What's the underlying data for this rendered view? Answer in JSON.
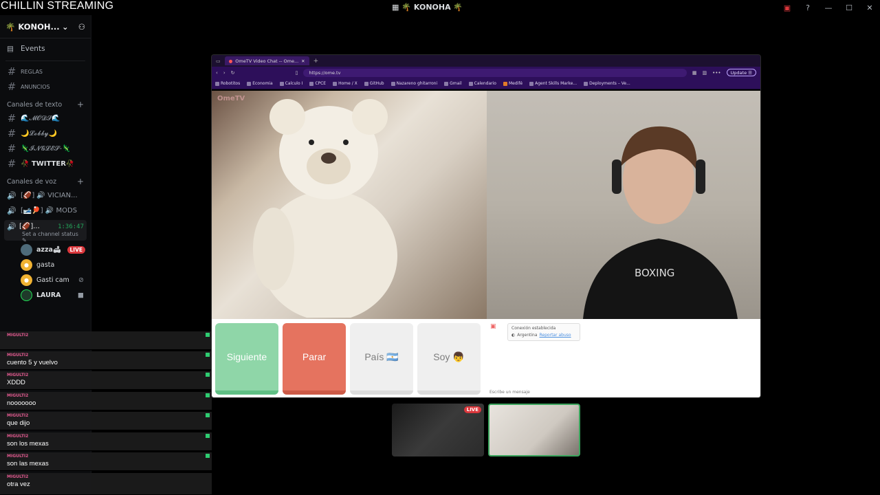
{
  "window": {
    "stream_title": "CHILLIN STREAMING",
    "server_title": "🌴 KONOHA 🌴"
  },
  "sidebar": {
    "server_name": "🌴 KONOH...",
    "events_label": "Events",
    "channels_top": [
      "REGLAS",
      "ANUNCIOS"
    ],
    "text_category": "Canales de texto",
    "text_channels": [
      "🌊𝓜𝓞𝓓𝓢🌊",
      "🌙𝓛𝓸𝓫𝓫𝔂🌙",
      "🦎𝓘𝓝𝓖𝓛𝓔𝓢-🦎",
      "🥀 TWITTER🥀"
    ],
    "voice_category": "Canales de voz",
    "voice_channels": [
      "[🏈] 🔊 VICIAN...",
      "[🎿🏓] 🔊 MODS"
    ],
    "active_voice": {
      "label": "[🏈]...",
      "time": "1:36:47",
      "status": "Set a channel status"
    },
    "voice_users": [
      {
        "name": "azza🛋",
        "live": "LIVE"
      },
      {
        "name": "gasta"
      },
      {
        "name": "Gasti cam"
      },
      {
        "name": "LAURA"
      }
    ]
  },
  "chat_overlay": {
    "messages": [
      {
        "user": "MIGULTI2",
        "text": ""
      },
      {
        "user": "MIGULTI2",
        "text": "cuento 5 y vuelvo"
      },
      {
        "user": "MIGULTI2",
        "text": "XDDD"
      },
      {
        "user": "MIGULTI2",
        "text": "nooooooo"
      },
      {
        "user": "MIGULTI2",
        "text": "que dijo"
      },
      {
        "user": "MIGULTI2",
        "text": "son los mexas"
      },
      {
        "user": "MIGULTI2",
        "text": "son las mexas"
      },
      {
        "user": "MIGULTI2",
        "text": "otra vez"
      }
    ]
  },
  "browser": {
    "tab_title": "OmeTV Video Chat -- Ome...",
    "url": "https://ome.tv",
    "update_label": "Update",
    "bookmarks": [
      "Robotitos",
      "Economia",
      "Calculo I",
      "CPCE",
      "Home / X",
      "GitHub",
      "Nazareno ghitarroni",
      "Gmail",
      "Calendario",
      "Medifé",
      "Agent Skills Marke...",
      "Deployments – Ve..."
    ],
    "logo": "OmeTV"
  },
  "ometv": {
    "buttons": {
      "next": "Siguiente",
      "stop": "Parar",
      "country": "País 🇦🇷",
      "me": "Soy 👦"
    },
    "connection": {
      "status": "Conexión establecida",
      "country": "Argentina",
      "report": "Reportar abuso"
    },
    "message_placeholder": "Escribe un mensaje"
  },
  "thumbnails": {
    "live_label": "LIVE"
  }
}
